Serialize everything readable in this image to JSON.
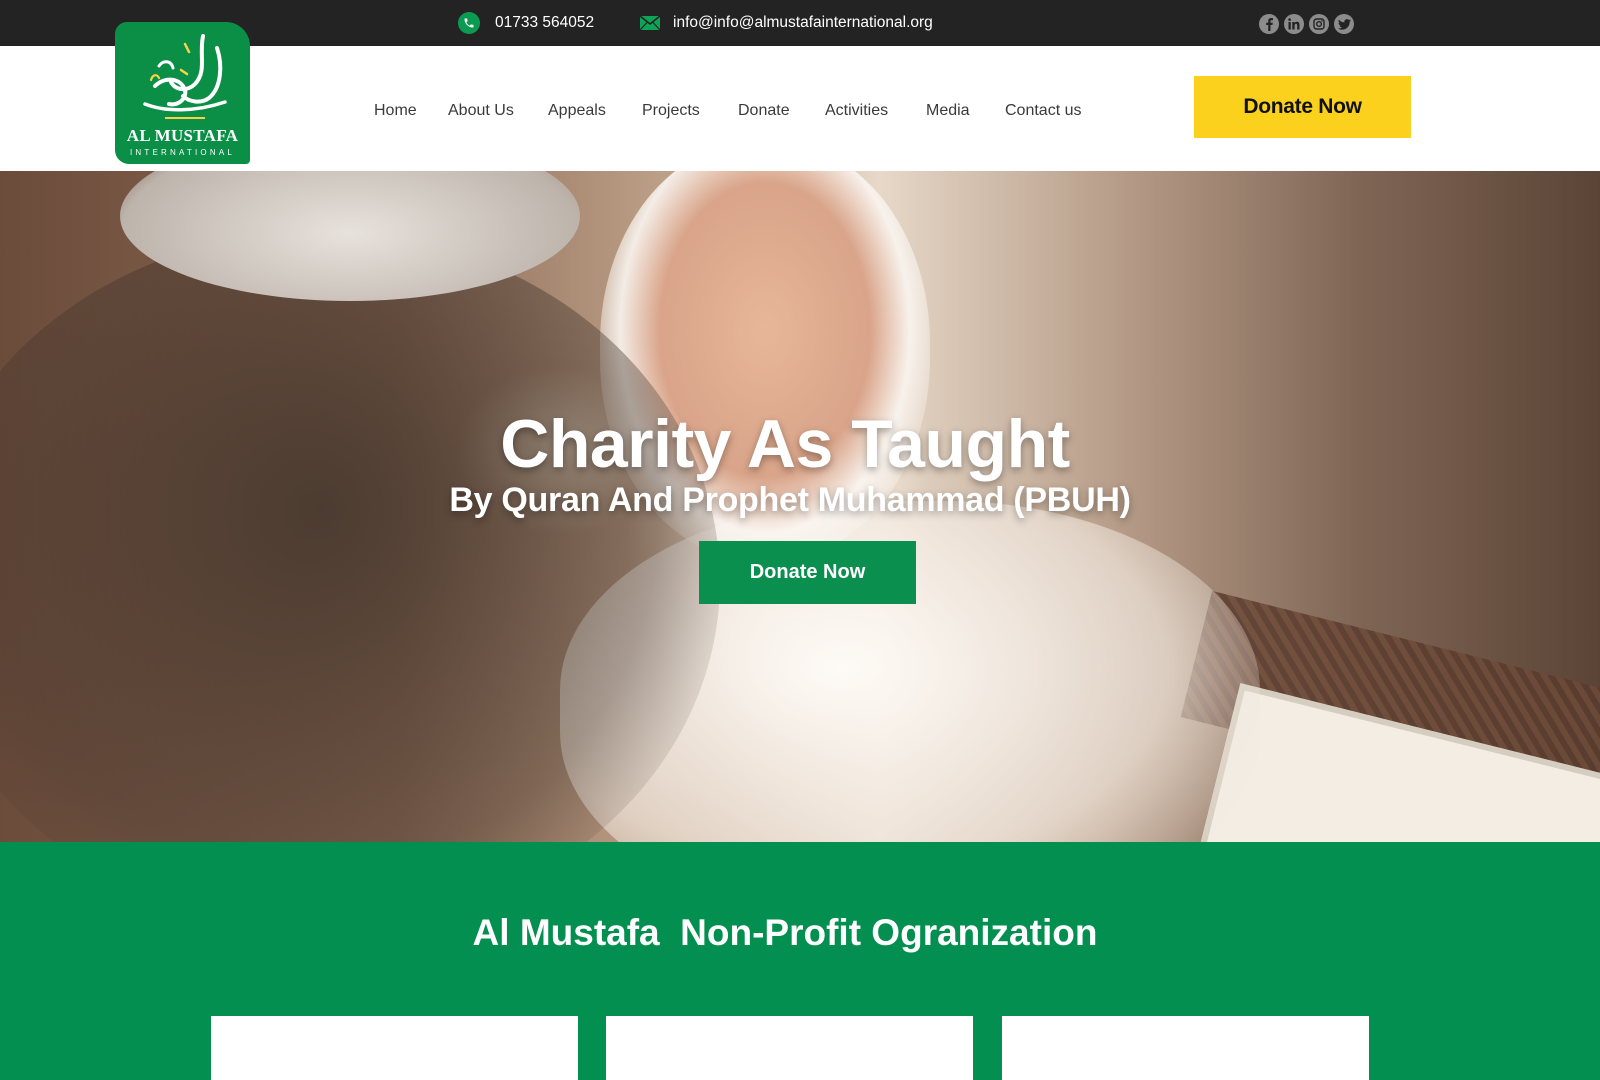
{
  "topbar": {
    "phone": "01733 564052",
    "email": "info@info@almustafainternational.org",
    "phone_icon": "phone-icon",
    "mail_icon": "envelope-icon",
    "socials": [
      "facebook-icon",
      "linkedin-icon",
      "instagram-icon",
      "twitter-icon"
    ]
  },
  "logo": {
    "name": "AL MUSTAFA",
    "subtitle": "INTERNATIONAL"
  },
  "nav": {
    "items": [
      "Home",
      "About Us",
      "Appeals",
      "Projects",
      "Donate",
      "Activities",
      "Media",
      "Contact us"
    ]
  },
  "header": {
    "donate_label": "Donate Now"
  },
  "hero": {
    "title": "Charity As Taught",
    "subtitle": "By Quran And Prophet Muhammad (PBUH)",
    "donate_label": "Donate Now"
  },
  "org": {
    "title": "Al Mustafa  Non-Profit Ogranization"
  },
  "colors": {
    "brand_green": "#038f50",
    "accent_yellow": "#fbd11e",
    "topbar": "#232323"
  }
}
